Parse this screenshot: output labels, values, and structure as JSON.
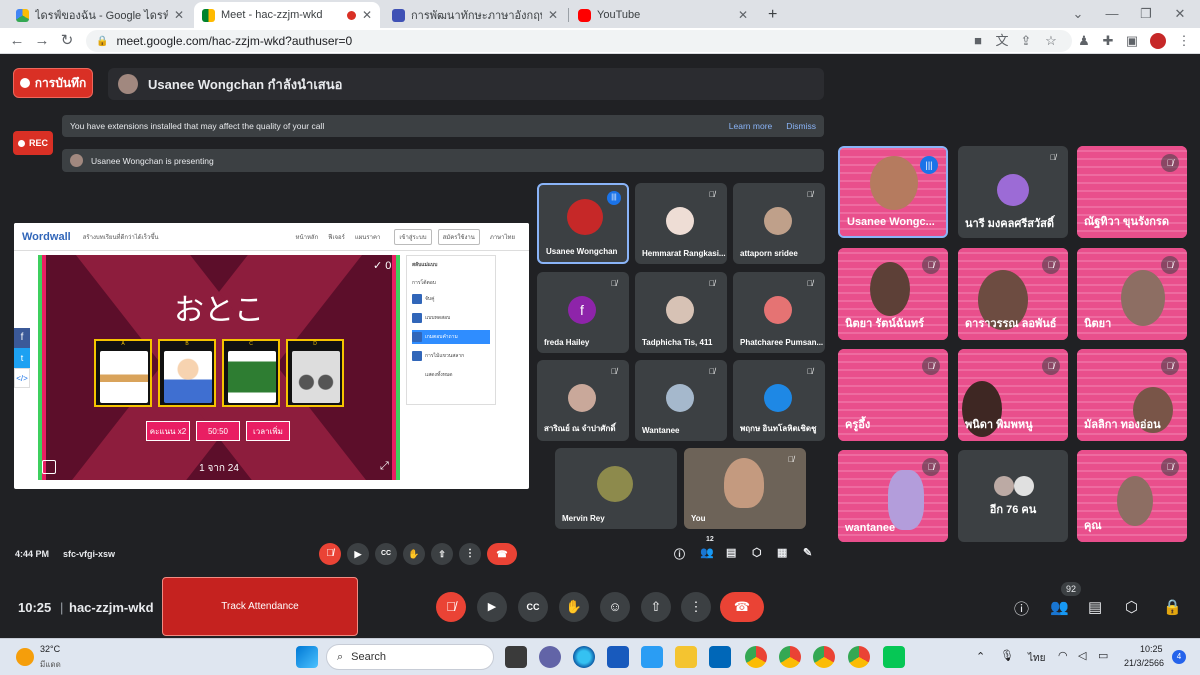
{
  "browser": {
    "tabs": [
      {
        "label": "ไดรฟ์ของฉัน - Google ไดรฟ์",
        "icon": "google-drive-icon",
        "active": false
      },
      {
        "label": "Meet - hac-zzjm-wkd",
        "icon": "google-meet-icon",
        "active": true
      },
      {
        "label": "การพัฒนาทักษะภาษาอังกฤษ English",
        "icon": "google-forms-icon",
        "active": false
      },
      {
        "label": "YouTube",
        "icon": "youtube-icon",
        "active": false
      }
    ],
    "new_tab": "+",
    "url": "meet.google.com/hac-zzjm-wkd?authuser=0"
  },
  "meet": {
    "record_button": "การบันทึก",
    "presenter_banner": "Usanee Wongchan กำลังนำเสนอ",
    "rec_label": "REC",
    "extension_notice": "You have extensions installed that may affect the quality of your call",
    "learn_more": "Learn more",
    "dismiss": "Dismiss",
    "presenting_notice": "Usanee Wongchan is presenting",
    "inner_time": "4:44 PM",
    "inner_code": "sfc-vfgi-xsw",
    "inner_people_count": "12",
    "time": "10:25",
    "meeting_code": "hac-zzjm-wkd",
    "track_attendance": "Track Attendance",
    "people_count": "92"
  },
  "wordwall": {
    "logo": "Wordwall",
    "tagline": "สร้างบทเรียนที่ดีกว่าได้เร็วขึ้น",
    "nav": [
      "หน้าหลัก",
      "ฟีเจอร์",
      "แผนราคา"
    ],
    "login": "เข้าสู่ระบบ",
    "signup": "สมัครใช้งาน",
    "language": "ภาษาไทย",
    "word": "おとこ",
    "card_letters": [
      "A",
      "B",
      "C",
      "D"
    ],
    "buttons": [
      "คะแนน x2",
      "50:50",
      "เวลาเพิ่ม"
    ],
    "counter": "1 จาก 24",
    "score": "0",
    "side_title": "สลับแม่แบบ",
    "side_subtitle": "การโต้ตอบ",
    "side_items": [
      "จับคู่",
      "แบบทดสอบ",
      "เกมตอบคำถาม",
      "การไม้แขวนสลาก",
      "แสดงทั้งหมด"
    ]
  },
  "inner_tiles": [
    {
      "name": "Usanee Wongchan",
      "speaking": true
    },
    {
      "name": "Hemmarat Rangkasi..."
    },
    {
      "name": "attaporn sridee"
    },
    {
      "name": "freda Hailey",
      "initial": "f"
    },
    {
      "name": "Tadphicha Tis, 411"
    },
    {
      "name": "Phatcharee Pumsan..."
    },
    {
      "name": "สาริณย์ ณ จำปาศักดิ์"
    },
    {
      "name": "Wantanee"
    },
    {
      "name": "พฤกษ อินทโลหิตเชิดชู"
    },
    {
      "name": "Mervin Rey"
    },
    {
      "name": "You"
    }
  ],
  "right_tiles": [
    {
      "name": "Usanee Wongc..."
    },
    {
      "name": "นารี มงคลศรีสวัสดิ์"
    },
    {
      "name": "ณัฐทิวา ขุนรังกรด"
    },
    {
      "name": "นิตยา รัตน์ฉันทร์"
    },
    {
      "name": "ดาราวรรณ ลอพันธ์"
    },
    {
      "name": "นิตยา"
    },
    {
      "name": "ครูอึ้ง"
    },
    {
      "name": "พนิดา พิมพหนู"
    },
    {
      "name": "มัลลิกา ทองอ่อน"
    },
    {
      "name": "wantanee"
    },
    {
      "name": "อีก 76 คน"
    },
    {
      "name": "คุณ"
    }
  ],
  "taskbar": {
    "temperature": "32°C",
    "weather": "มีแดด",
    "search": "Search",
    "lang": "ไทย",
    "time": "10:25",
    "date": "21/3/2566",
    "notifications": "4"
  },
  "colors": {
    "accent_red": "#ea4335",
    "pink_slide": "#e94f8c",
    "meet_bg": "#202124"
  }
}
